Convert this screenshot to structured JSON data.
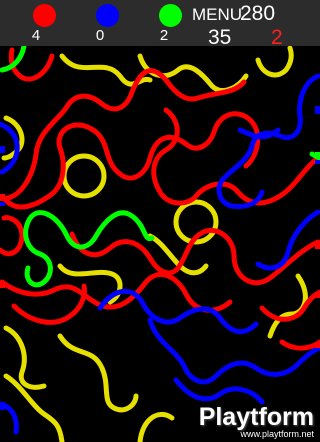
{
  "hud": {
    "counters": [
      {
        "color": "#ff0000",
        "count": "4",
        "icon": "red-ball-icon"
      },
      {
        "color": "#0000ff",
        "count": "0",
        "icon": "blue-ball-icon"
      },
      {
        "color": "#00ff00",
        "count": "2",
        "icon": "green-ball-icon"
      }
    ],
    "menu_label": "MENU",
    "score": "280",
    "moves": "35",
    "lives": "2",
    "lives_color": "#ff2020"
  },
  "board": {
    "colors": {
      "red": "#ff0000",
      "blue": "#0000ff",
      "green": "#00ff00",
      "yellow": "#e6e000",
      "background": "#000000"
    }
  },
  "watermark": {
    "name": "Playtform",
    "url": "www.playtform.net"
  }
}
